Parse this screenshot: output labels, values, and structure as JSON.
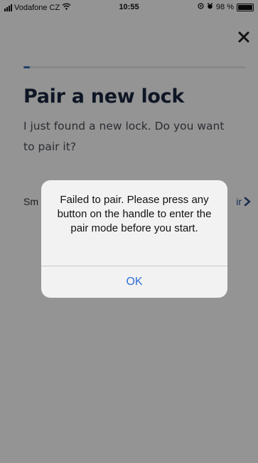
{
  "status_bar": {
    "carrier": "Vodafone CZ",
    "time": "10:55",
    "battery_percent": "98 %",
    "battery_level": 0.98
  },
  "page": {
    "progress": 0.03,
    "title": "Pair a new lock",
    "subtitle": "I just found a new lock. Do you want to pair it?",
    "row_left_label": "Sm",
    "row_right_label": "ir"
  },
  "alert": {
    "message": "Failed to pair. Please press any button on the handle to enter the pair mode before you start.",
    "ok_label": "OK"
  },
  "colors": {
    "accent": "#3d6fb8",
    "title": "#1a2740",
    "alert_button": "#2f6fd6"
  },
  "icons": [
    "signal-icon",
    "wifi-icon",
    "location-icon",
    "alarm-icon",
    "battery-icon",
    "close-icon",
    "chevron-right-icon"
  ]
}
